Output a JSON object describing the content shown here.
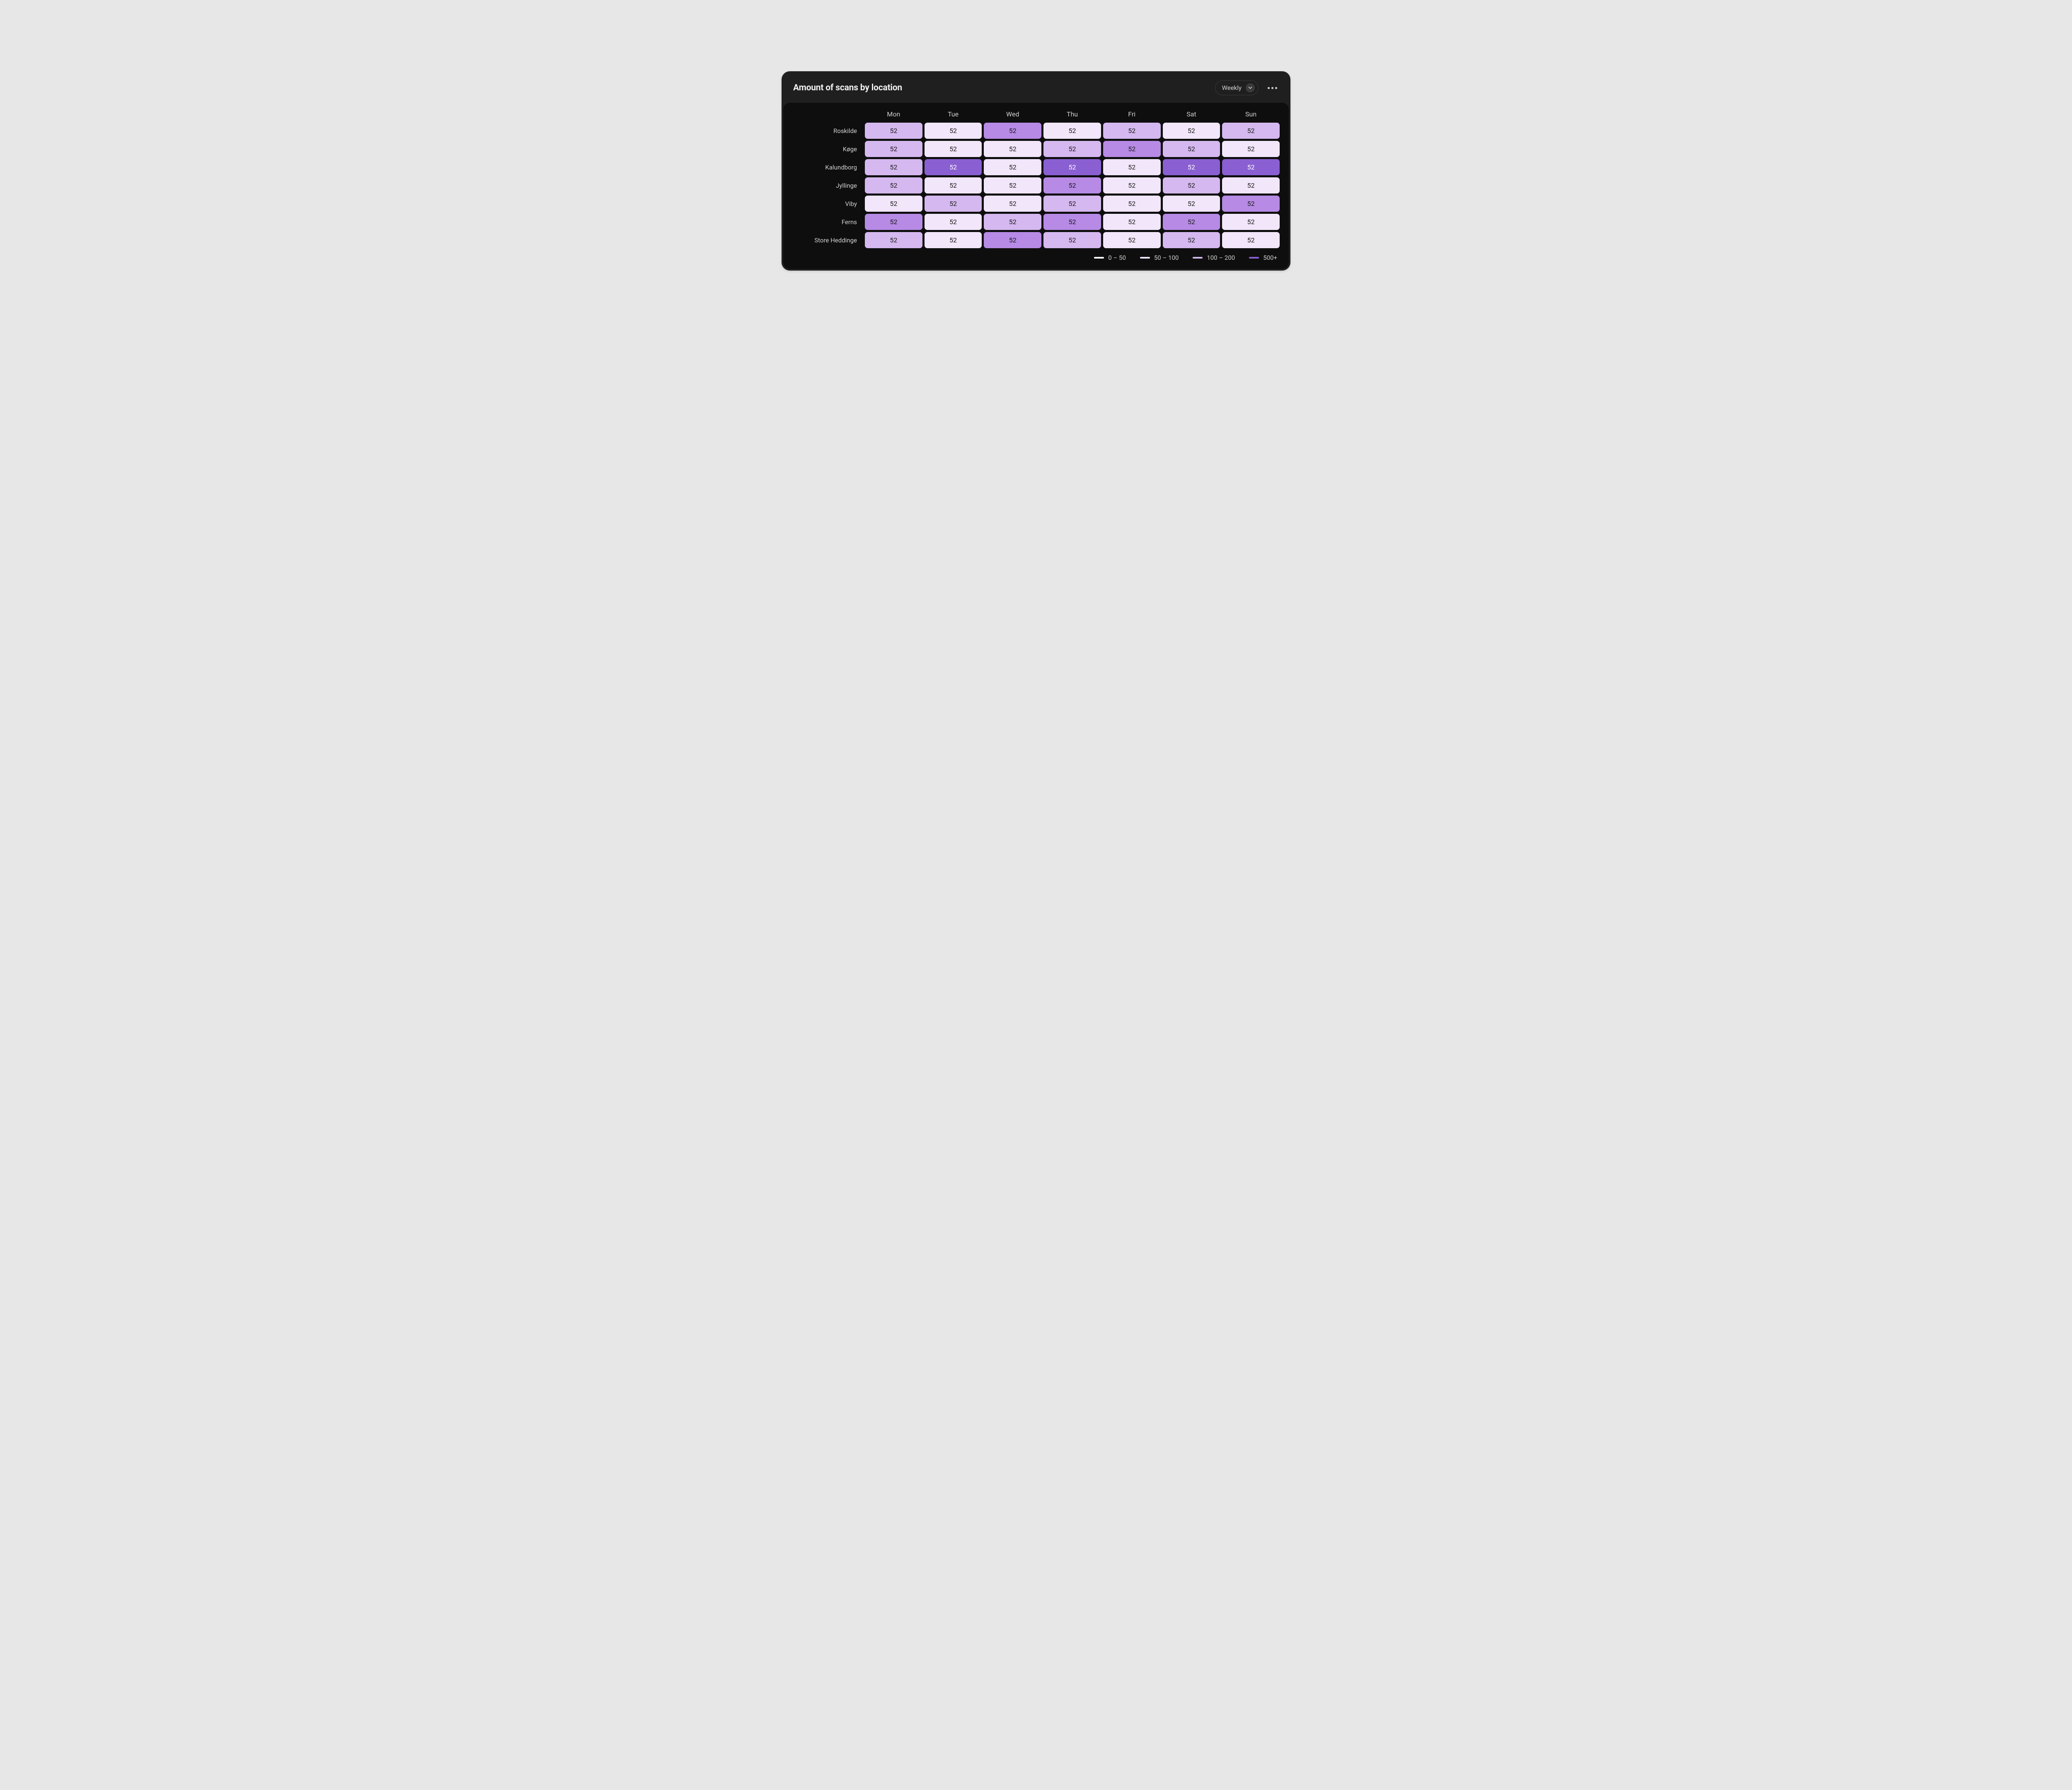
{
  "header": {
    "title": "Amount of scans by location",
    "period_selector": {
      "label": "Weekly"
    }
  },
  "colors": {
    "l0": "#ffffff",
    "l1": "#f1e6fa",
    "l2": "#d5b8ef",
    "l3": "#b68ae5",
    "l4": "#8a5fd2"
  },
  "legend": [
    {
      "label": "0 – 50",
      "colorKey": "l0"
    },
    {
      "label": "50 – 100",
      "colorKey": "l1"
    },
    {
      "label": "100 – 200",
      "colorKey": "l2"
    },
    {
      "label": "500+",
      "colorKey": "l4"
    }
  ],
  "days": [
    "Mon",
    "Tue",
    "Wed",
    "Thu",
    "Fri",
    "Sat",
    "Sun"
  ],
  "locations": [
    "Roskilde",
    "Køge",
    "Kalundborg",
    "Jyllinge",
    "Viby",
    "Ferns",
    "Store Heddinge"
  ],
  "chart_data": {
    "type": "heatmap",
    "title": "Amount of scans by location",
    "xlabel": "",
    "ylabel": "",
    "x": [
      "Mon",
      "Tue",
      "Wed",
      "Thu",
      "Fri",
      "Sat",
      "Sun"
    ],
    "y": [
      "Roskilde",
      "Køge",
      "Kalundborg",
      "Jyllinge",
      "Viby",
      "Ferns",
      "Store Heddinge"
    ],
    "values": [
      [
        52,
        52,
        52,
        52,
        52,
        52,
        52
      ],
      [
        52,
        52,
        52,
        52,
        52,
        52,
        52
      ],
      [
        52,
        52,
        52,
        52,
        52,
        52,
        52
      ],
      [
        52,
        52,
        52,
        52,
        52,
        52,
        52
      ],
      [
        52,
        52,
        52,
        52,
        52,
        52,
        52
      ],
      [
        52,
        52,
        52,
        52,
        52,
        52,
        52
      ],
      [
        52,
        52,
        52,
        52,
        52,
        52,
        52
      ]
    ],
    "cell_levels": [
      [
        "l2",
        "l1",
        "l3",
        "l1",
        "l2",
        "l1",
        "l2"
      ],
      [
        "l2",
        "l1",
        "l1",
        "l2",
        "l3",
        "l2",
        "l1"
      ],
      [
        "l2",
        "l4",
        "l1",
        "l4",
        "l1",
        "l4",
        "l4"
      ],
      [
        "l2",
        "l1",
        "l1",
        "l3",
        "l1",
        "l2",
        "l1"
      ],
      [
        "l1",
        "l2",
        "l1",
        "l2",
        "l1",
        "l1",
        "l3"
      ],
      [
        "l3",
        "l1",
        "l2",
        "l3",
        "l1",
        "l3",
        "l1"
      ],
      [
        "l2",
        "l1",
        "l3",
        "l2",
        "l1",
        "l2",
        "l1"
      ]
    ],
    "legend_bins": [
      {
        "label": "0 – 50",
        "colorKey": "l0"
      },
      {
        "label": "50 – 100",
        "colorKey": "l1"
      },
      {
        "label": "100 – 200",
        "colorKey": "l2"
      },
      {
        "label": "500+",
        "colorKey": "l4"
      }
    ]
  }
}
